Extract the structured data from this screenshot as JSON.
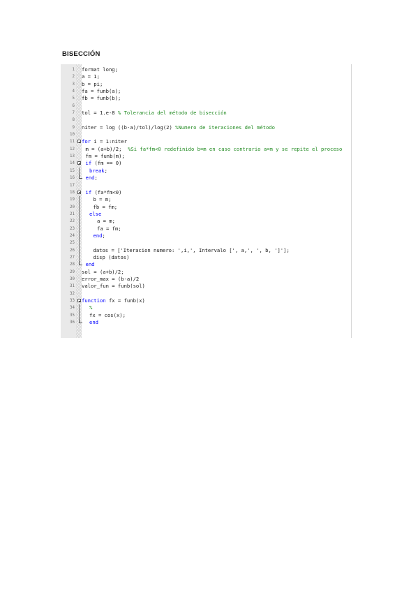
{
  "heading": "BISECCIÓN",
  "code_lines": [
    {
      "n": "1",
      "indent": 0,
      "parts": [
        {
          "t": "format long;",
          "c": "pl"
        }
      ]
    },
    {
      "n": "2",
      "indent": 0,
      "parts": [
        {
          "t": "a = 1;",
          "c": "pl"
        }
      ]
    },
    {
      "n": "3",
      "indent": 0,
      "parts": [
        {
          "t": "b = pi;",
          "c": "pl"
        }
      ]
    },
    {
      "n": "4",
      "indent": 0,
      "parts": [
        {
          "t": "fa = funb(a);",
          "c": "pl"
        }
      ]
    },
    {
      "n": "5",
      "indent": 0,
      "parts": [
        {
          "t": "fb = funb(b);",
          "c": "pl"
        }
      ]
    },
    {
      "n": "6",
      "indent": 0,
      "parts": []
    },
    {
      "n": "7",
      "indent": 0,
      "parts": [
        {
          "t": "tol = 1.e-8 ",
          "c": "pl"
        },
        {
          "t": "% Tolerancia del método de bisección",
          "c": "cm"
        }
      ]
    },
    {
      "n": "8",
      "indent": 0,
      "parts": []
    },
    {
      "n": "9",
      "indent": 0,
      "parts": [
        {
          "t": "niter = log ((b-a)/tol)/log(2) ",
          "c": "pl"
        },
        {
          "t": "%Numero de iteraciones del método",
          "c": "cm"
        }
      ]
    },
    {
      "n": "10",
      "indent": 0,
      "parts": []
    },
    {
      "n": "11",
      "indent": 0,
      "fold": "start",
      "parts": [
        {
          "t": "for",
          "c": "kw"
        },
        {
          "t": " i = 1:niter",
          "c": "pl"
        }
      ]
    },
    {
      "n": "12",
      "indent": 1,
      "parts": [
        {
          "t": "m = (a+b)/2;  ",
          "c": "pl"
        },
        {
          "t": "%Si fa*fm<0 redefinido b=m en caso contrario a=m y se repite el proceso",
          "c": "cm"
        }
      ]
    },
    {
      "n": "13",
      "indent": 1,
      "parts": [
        {
          "t": "fm = funb(m);",
          "c": "pl"
        }
      ]
    },
    {
      "n": "14",
      "indent": 1,
      "fold": "start",
      "parts": [
        {
          "t": "if",
          "c": "kw"
        },
        {
          "t": " (fm == 0)",
          "c": "pl"
        }
      ]
    },
    {
      "n": "15",
      "indent": 2,
      "parts": [
        {
          "t": "break",
          "c": "kw"
        },
        {
          "t": ";",
          "c": "pl"
        }
      ]
    },
    {
      "n": "16",
      "indent": 1,
      "fold": "end",
      "parts": [
        {
          "t": "end",
          "c": "kw"
        },
        {
          "t": ";",
          "c": "pl"
        }
      ]
    },
    {
      "n": "17",
      "indent": 0,
      "parts": []
    },
    {
      "n": "18",
      "indent": 1,
      "fold": "start",
      "parts": [
        {
          "t": "if",
          "c": "kw"
        },
        {
          "t": " (fa*fm<0)",
          "c": "pl"
        }
      ]
    },
    {
      "n": "19",
      "indent": 3,
      "parts": [
        {
          "t": "b = m;",
          "c": "pl"
        }
      ]
    },
    {
      "n": "20",
      "indent": 3,
      "parts": [
        {
          "t": "fb = fm;",
          "c": "pl"
        }
      ]
    },
    {
      "n": "21",
      "indent": 2,
      "parts": [
        {
          "t": "else",
          "c": "kw"
        }
      ]
    },
    {
      "n": "22",
      "indent": 4,
      "parts": [
        {
          "t": "a = m;",
          "c": "pl"
        }
      ]
    },
    {
      "n": "23",
      "indent": 4,
      "parts": [
        {
          "t": "fa = fm;",
          "c": "pl"
        }
      ]
    },
    {
      "n": "24",
      "indent": 3,
      "parts": [
        {
          "t": "end",
          "c": "kw"
        },
        {
          "t": ";",
          "c": "pl"
        }
      ]
    },
    {
      "n": "25",
      "indent": 0,
      "parts": []
    },
    {
      "n": "26",
      "indent": 3,
      "parts": [
        {
          "t": "datos = ['Iteracion numero: ',i,', Intervalo [', a,', ', b, ']'];",
          "c": "pl"
        }
      ]
    },
    {
      "n": "27",
      "indent": 3,
      "parts": [
        {
          "t": "disp (datos)",
          "c": "pl"
        }
      ]
    },
    {
      "n": "28",
      "indent": 1,
      "fold": "end",
      "parts": [
        {
          "t": "end",
          "c": "kw"
        }
      ]
    },
    {
      "n": "29",
      "indent": 0,
      "parts": [
        {
          "t": "sol = (a+b)/2;",
          "c": "pl"
        }
      ]
    },
    {
      "n": "30",
      "indent": 0,
      "parts": [
        {
          "t": "error_max = (b-a)/2",
          "c": "pl"
        }
      ]
    },
    {
      "n": "31",
      "indent": 0,
      "parts": [
        {
          "t": "valor_fun = funb(sol)",
          "c": "pl"
        }
      ]
    },
    {
      "n": "32",
      "indent": 0,
      "parts": []
    },
    {
      "n": "33",
      "indent": 0,
      "fold": "start",
      "parts": [
        {
          "t": "function",
          "c": "kw"
        },
        {
          "t": " fx = funb(x)",
          "c": "pl"
        }
      ]
    },
    {
      "n": "34",
      "indent": 2,
      "parts": [
        {
          "t": "%",
          "c": "cm"
        }
      ]
    },
    {
      "n": "35",
      "indent": 2,
      "parts": [
        {
          "t": "fx = cos(x);",
          "c": "pl"
        }
      ]
    },
    {
      "n": "36",
      "indent": 2,
      "fold": "end",
      "parts": [
        {
          "t": "end",
          "c": "kw"
        }
      ]
    }
  ]
}
